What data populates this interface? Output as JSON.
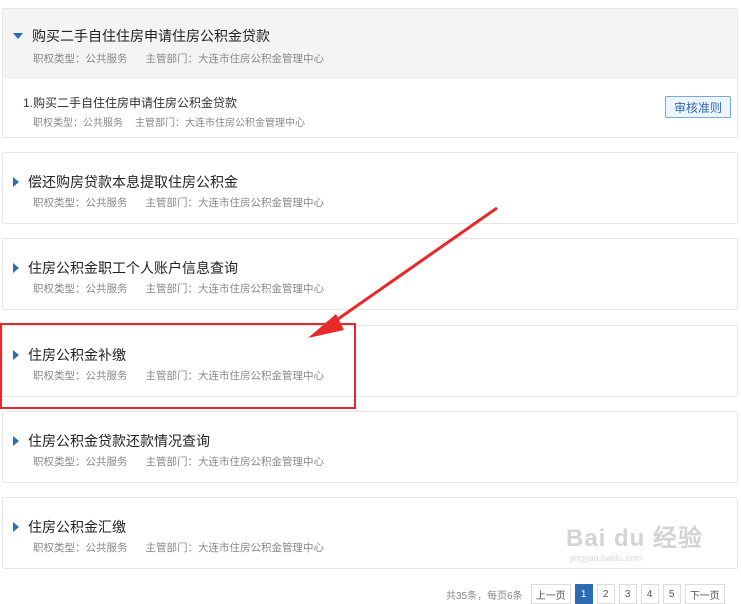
{
  "meta_labels": {
    "type": "职权类型：公共服务",
    "dept": "主管部门：大连市住房公积金管理中心"
  },
  "services": [
    {
      "title": "购买二手自住住房申请住房公积金贷款",
      "expanded": true,
      "sub_item": {
        "title": "1.购买二手自住住房申请住房公积金贷款",
        "button": "审核准则"
      }
    },
    {
      "title": "偿还购房贷款本息提取住房公积金"
    },
    {
      "title": "住房公积金职工个人账户信息查询"
    },
    {
      "title": "住房公积金补缴",
      "highlighted": true
    },
    {
      "title": "住房公积金贷款还款情况查询"
    },
    {
      "title": "住房公积金汇缴"
    }
  ],
  "pagination": {
    "info": "共35条，每页6条",
    "prev": "上一页",
    "pages": [
      "1",
      "2",
      "3",
      "4",
      "5"
    ],
    "current": "1",
    "next": "下一页"
  },
  "watermark": {
    "brand": "Bai du 经验",
    "url": "jingyan.baidu.com"
  },
  "colors": {
    "accent": "#2d6bb5",
    "highlight": "#e8292a"
  }
}
